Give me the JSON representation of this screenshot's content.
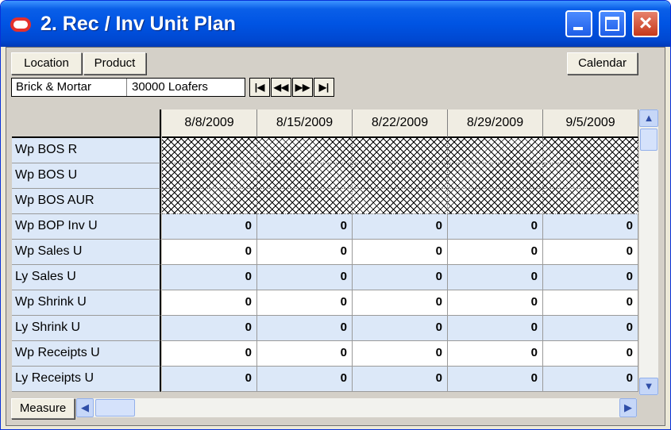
{
  "window": {
    "title": "2. Rec / Inv Unit Plan",
    "controls": {
      "minimize_icon": "minimize-icon",
      "maximize_icon": "maximize-icon",
      "close_icon": "close-icon"
    }
  },
  "toolbar": {
    "location_label": "Location",
    "product_label": "Product",
    "calendar_label": "Calendar"
  },
  "context": {
    "location": "Brick & Mortar",
    "product": "30000 Loafers"
  },
  "nav": {
    "first_icon": "first-page-icon",
    "prev_icon": "previous-page-icon",
    "next_icon": "next-page-icon",
    "last_icon": "last-page-icon"
  },
  "grid": {
    "columns": [
      "8/8/2009",
      "8/15/2009",
      "8/22/2009",
      "8/29/2009",
      "9/5/2009"
    ],
    "rows": [
      {
        "label": "Wp BOS R",
        "values": null
      },
      {
        "label": "Wp BOS U",
        "values": null
      },
      {
        "label": "Wp BOS AUR",
        "values": null
      },
      {
        "label": "Wp BOP Inv U",
        "values": [
          "0",
          "0",
          "0",
          "0",
          "0"
        ]
      },
      {
        "label": "Wp Sales U",
        "values": [
          "0",
          "0",
          "0",
          "0",
          "0"
        ]
      },
      {
        "label": "Ly Sales U",
        "values": [
          "0",
          "0",
          "0",
          "0",
          "0"
        ]
      },
      {
        "label": "Wp Shrink U",
        "values": [
          "0",
          "0",
          "0",
          "0",
          "0"
        ]
      },
      {
        "label": "Ly Shrink U",
        "values": [
          "0",
          "0",
          "0",
          "0",
          "0"
        ]
      },
      {
        "label": "Wp Receipts U",
        "values": [
          "0",
          "0",
          "0",
          "0",
          "0"
        ]
      },
      {
        "label": "Ly Receipts U",
        "values": [
          "0",
          "0",
          "0",
          "0",
          "0"
        ]
      }
    ]
  },
  "bottom": {
    "measure_label": "Measure"
  },
  "colors": {
    "title_bar": "#0054e3",
    "row_label_bg": "#dce8f8",
    "alt_row_bg": "#dce8f8",
    "close_button": "#d8543a"
  }
}
